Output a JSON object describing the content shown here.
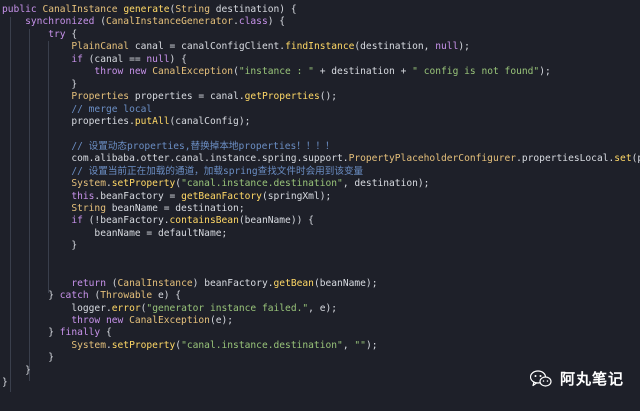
{
  "editor": {
    "language": "java",
    "colors": {
      "background": "#1e2029",
      "keyword": "#c792ea",
      "type": "#e5c07b",
      "function": "#ffd866",
      "string": "#98c379",
      "comment": "#6b8ec4",
      "text": "#d7dae0"
    },
    "lines": [
      [
        {
          "t": "public ",
          "c": "kw"
        },
        {
          "t": "CanalInstance ",
          "c": "ty"
        },
        {
          "t": "generate",
          "c": "fn"
        },
        {
          "t": "(",
          "c": "pu"
        },
        {
          "t": "String ",
          "c": "ty"
        },
        {
          "t": "destination) {",
          "c": "pa"
        }
      ],
      [
        {
          "t": "    "
        },
        {
          "t": "synchronized ",
          "c": "kw"
        },
        {
          "t": "(",
          "c": "pu"
        },
        {
          "t": "CanalInstanceGenerator",
          "c": "ty"
        },
        {
          "t": ".",
          "c": "pu"
        },
        {
          "t": "class",
          "c": "kw"
        },
        {
          "t": ") {",
          "c": "pu"
        }
      ],
      [
        {
          "t": "        "
        },
        {
          "t": "try ",
          "c": "kw"
        },
        {
          "t": "{",
          "c": "pu"
        }
      ],
      [
        {
          "t": "            "
        },
        {
          "t": "PlainCanal ",
          "c": "ty"
        },
        {
          "t": "canal ",
          "c": "df"
        },
        {
          "t": "= ",
          "c": "pu"
        },
        {
          "t": "canalConfigClient",
          "c": "df"
        },
        {
          "t": ".",
          "c": "pu"
        },
        {
          "t": "findInstance",
          "c": "fn"
        },
        {
          "t": "(destination, ",
          "c": "pa"
        },
        {
          "t": "null",
          "c": "kw"
        },
        {
          "t": ");",
          "c": "pu"
        }
      ],
      [
        {
          "t": "            "
        },
        {
          "t": "if ",
          "c": "kw"
        },
        {
          "t": "(canal == ",
          "c": "pa"
        },
        {
          "t": "null",
          "c": "kw"
        },
        {
          "t": ") {",
          "c": "pu"
        }
      ],
      [
        {
          "t": "                "
        },
        {
          "t": "throw new ",
          "c": "kw"
        },
        {
          "t": "CanalException",
          "c": "ty"
        },
        {
          "t": "(",
          "c": "pu"
        },
        {
          "t": "\"instance : \"",
          "c": "st"
        },
        {
          "t": " + destination + ",
          "c": "pa"
        },
        {
          "t": "\" config is not found\"",
          "c": "st"
        },
        {
          "t": ");",
          "c": "pu"
        }
      ],
      [
        {
          "t": "            "
        },
        {
          "t": "}",
          "c": "pu"
        }
      ],
      [
        {
          "t": "            "
        },
        {
          "t": "Properties ",
          "c": "ty"
        },
        {
          "t": "properties ",
          "c": "df"
        },
        {
          "t": "= ",
          "c": "pu"
        },
        {
          "t": "canal",
          "c": "df"
        },
        {
          "t": ".",
          "c": "pu"
        },
        {
          "t": "getProperties",
          "c": "fn"
        },
        {
          "t": "();",
          "c": "pu"
        }
      ],
      [
        {
          "t": "            "
        },
        {
          "t": "// merge local",
          "c": "cm"
        }
      ],
      [
        {
          "t": "            "
        },
        {
          "t": "properties",
          "c": "df"
        },
        {
          "t": ".",
          "c": "pu"
        },
        {
          "t": "putAll",
          "c": "fn"
        },
        {
          "t": "(canalConfig);",
          "c": "pa"
        }
      ],
      [
        {
          "t": ""
        }
      ],
      [
        {
          "t": "            "
        },
        {
          "t": "// 设置动态properties,替换掉本地properties！！！！",
          "c": "cm"
        }
      ],
      [
        {
          "t": "            "
        },
        {
          "t": "com.alibaba.otter.canal.instance.spring.support.",
          "c": "df"
        },
        {
          "t": "PropertyPlaceholderConfigurer",
          "c": "ty"
        },
        {
          "t": ".",
          "c": "pu"
        },
        {
          "t": "propertiesLocal",
          "c": "df"
        },
        {
          "t": ".",
          "c": "pu"
        },
        {
          "t": "set",
          "c": "fn"
        },
        {
          "t": "(properties);",
          "c": "pa"
        }
      ],
      [
        {
          "t": "            "
        },
        {
          "t": "// 设置当前正在加载的通道，加载spring查找文件时会用到该变量",
          "c": "cm"
        }
      ],
      [
        {
          "t": "            "
        },
        {
          "t": "System",
          "c": "ty"
        },
        {
          "t": ".",
          "c": "pu"
        },
        {
          "t": "setProperty",
          "c": "fn"
        },
        {
          "t": "(",
          "c": "pu"
        },
        {
          "t": "\"canal.instance.destination\"",
          "c": "st"
        },
        {
          "t": ", destination);",
          "c": "pa"
        }
      ],
      [
        {
          "t": "            "
        },
        {
          "t": "this",
          "c": "kw"
        },
        {
          "t": ".",
          "c": "pu"
        },
        {
          "t": "beanFactory ",
          "c": "df"
        },
        {
          "t": "= ",
          "c": "pu"
        },
        {
          "t": "getBeanFactory",
          "c": "fn"
        },
        {
          "t": "(springXml);",
          "c": "pa"
        }
      ],
      [
        {
          "t": "            "
        },
        {
          "t": "String ",
          "c": "ty"
        },
        {
          "t": "beanName ",
          "c": "df"
        },
        {
          "t": "= destination;",
          "c": "pa"
        }
      ],
      [
        {
          "t": "            "
        },
        {
          "t": "if ",
          "c": "kw"
        },
        {
          "t": "(!",
          "c": "pu"
        },
        {
          "t": "beanFactory",
          "c": "df"
        },
        {
          "t": ".",
          "c": "pu"
        },
        {
          "t": "containsBean",
          "c": "fn"
        },
        {
          "t": "(beanName)) {",
          "c": "pa"
        }
      ],
      [
        {
          "t": "                "
        },
        {
          "t": "beanName = defaultName;",
          "c": "pa"
        }
      ],
      [
        {
          "t": "            "
        },
        {
          "t": "}",
          "c": "pu"
        }
      ],
      [
        {
          "t": ""
        }
      ],
      [
        {
          "t": ""
        }
      ],
      [
        {
          "t": "            "
        },
        {
          "t": "return ",
          "c": "kw"
        },
        {
          "t": "(",
          "c": "pu"
        },
        {
          "t": "CanalInstance",
          "c": "ty"
        },
        {
          "t": ") ",
          "c": "pu"
        },
        {
          "t": "beanFactory",
          "c": "df"
        },
        {
          "t": ".",
          "c": "pu"
        },
        {
          "t": "getBean",
          "c": "fn"
        },
        {
          "t": "(beanName);",
          "c": "pa"
        }
      ],
      [
        {
          "t": "        "
        },
        {
          "t": "} ",
          "c": "pu"
        },
        {
          "t": "catch ",
          "c": "kw"
        },
        {
          "t": "(",
          "c": "pu"
        },
        {
          "t": "Throwable ",
          "c": "ty"
        },
        {
          "t": "e) {",
          "c": "pa"
        }
      ],
      [
        {
          "t": "            "
        },
        {
          "t": "logger",
          "c": "df"
        },
        {
          "t": ".",
          "c": "pu"
        },
        {
          "t": "error",
          "c": "fn"
        },
        {
          "t": "(",
          "c": "pu"
        },
        {
          "t": "\"generator instance failed.\"",
          "c": "st"
        },
        {
          "t": ", e);",
          "c": "pa"
        }
      ],
      [
        {
          "t": "            "
        },
        {
          "t": "throw new ",
          "c": "kw"
        },
        {
          "t": "CanalException",
          "c": "ty"
        },
        {
          "t": "(e);",
          "c": "pa"
        }
      ],
      [
        {
          "t": "        "
        },
        {
          "t": "} ",
          "c": "pu"
        },
        {
          "t": "finally ",
          "c": "kw"
        },
        {
          "t": "{",
          "c": "pu"
        }
      ],
      [
        {
          "t": "            "
        },
        {
          "t": "System",
          "c": "ty"
        },
        {
          "t": ".",
          "c": "pu"
        },
        {
          "t": "setProperty",
          "c": "fn"
        },
        {
          "t": "(",
          "c": "pu"
        },
        {
          "t": "\"canal.instance.destination\"",
          "c": "st"
        },
        {
          "t": ", ",
          "c": "pa"
        },
        {
          "t": "\"\"",
          "c": "st"
        },
        {
          "t": ");",
          "c": "pu"
        }
      ],
      [
        {
          "t": "        "
        },
        {
          "t": "}",
          "c": "pu"
        }
      ],
      [
        {
          "t": "    "
        },
        {
          "t": "}",
          "c": "pu"
        }
      ],
      [
        {
          "t": "}",
          "c": "pu"
        }
      ]
    ]
  },
  "watermark": {
    "icon": "wechat-icon",
    "text": "阿丸笔记"
  }
}
